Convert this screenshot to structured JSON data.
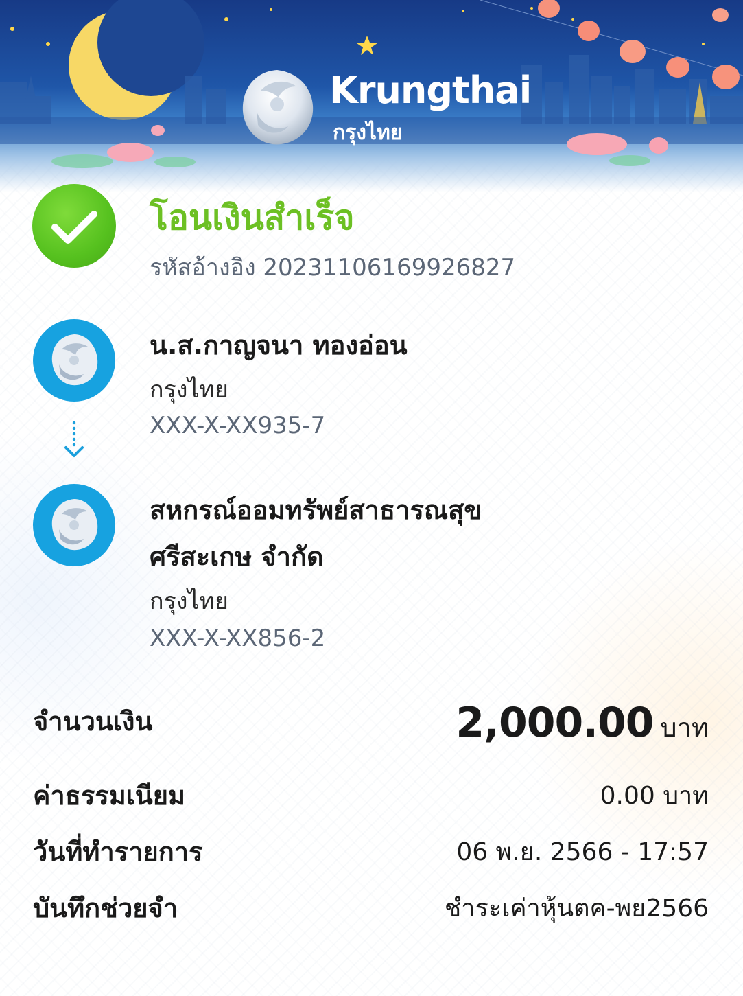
{
  "header": {
    "logo_en": "Krungthai",
    "logo_th": "กรุงไทย"
  },
  "status": {
    "title": "โอนเงินสำเร็จ",
    "ref_label": "รหัสอ้างอิง",
    "ref_number": "2023110616992682​7",
    "color": "#6cc024"
  },
  "sender": {
    "name": "น.ส.กาญจนา ทองอ่อน",
    "bank": "กรุงไทย",
    "account": "XXX-X-XX935-7"
  },
  "receiver": {
    "name_line1": "สหกรณ์ออมทรัพย์สาธารณสุข",
    "name_line2": "ศรีสะเกษ จำกัด",
    "bank": "กรุงไทย",
    "account": "XXX-X-XX856-2"
  },
  "details": {
    "amount_label": "จำนวนเงิน",
    "amount_value": "2,000.00",
    "amount_unit": "บาท",
    "fee_label": "ค่าธรรมเนียม",
    "fee_value": "0.00 บาท",
    "date_label": "วันที่ทำรายการ",
    "date_value": "06 พ.ย. 2566 - 17:57",
    "memo_label": "บันทึกช่วยจำ",
    "memo_value": "ชำระเค่าหุ้นตค-พย2566"
  },
  "icons": {
    "success": "check-circle-icon",
    "bank_logo": "krungthai-garuda-icon",
    "transfer_arrow": "arrow-down-icon"
  },
  "colors": {
    "brand_blue": "#17a2e0",
    "banner_dark": "#173a86",
    "success_green": "#56c11f"
  }
}
